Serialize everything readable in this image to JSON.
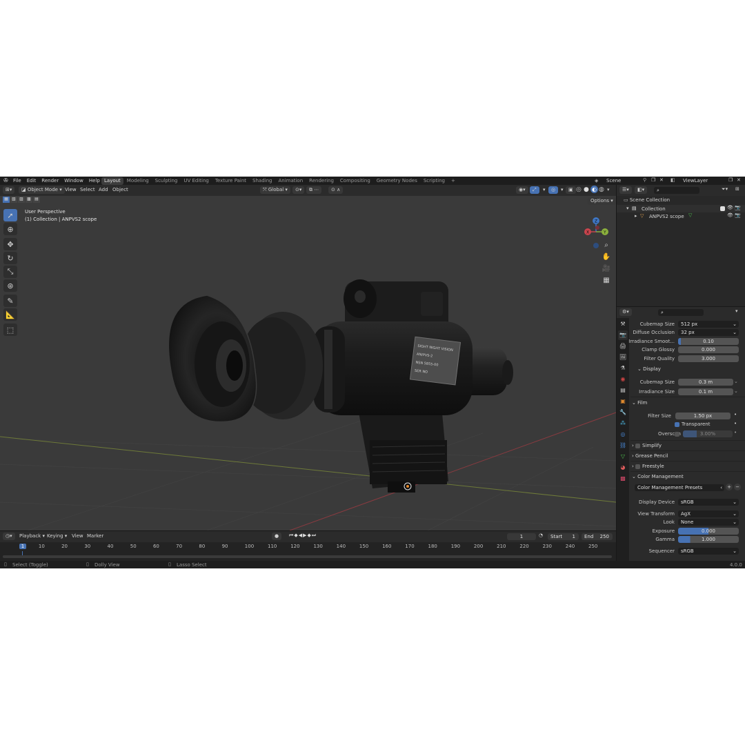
{
  "topbar": {
    "menus": [
      "File",
      "Edit",
      "Render",
      "Window",
      "Help"
    ],
    "workspaces": [
      "Layout",
      "Modeling",
      "Sculpting",
      "UV Editing",
      "Texture Paint",
      "Shading",
      "Animation",
      "Rendering",
      "Compositing",
      "Geometry Nodes",
      "Scripting"
    ],
    "active_workspace": "Layout",
    "add_tab": "+",
    "scene": "Scene",
    "view_layer": "ViewLayer"
  },
  "viewport": {
    "mode": "Object Mode",
    "menus": [
      "View",
      "Select",
      "Add",
      "Object"
    ],
    "orientation": "Global",
    "options_label": "Options",
    "overlay_line1": "User Perspective",
    "overlay_line2": "(1) Collection | ANPVS2 scope",
    "gizmo": {
      "z": "Z",
      "y": "Y",
      "x": "X"
    },
    "plate_lines": [
      "SIGHT NIGHT VISION",
      "AN/PVS-2",
      "NSN 5855-00",
      "SER NO"
    ]
  },
  "timeline": {
    "menus": [
      "Playback",
      "Keying",
      "View",
      "Marker"
    ],
    "current_frame": "1",
    "start_label": "Start",
    "start": "1",
    "end_label": "End",
    "end": "250",
    "ticks": [
      "1",
      "10",
      "20",
      "30",
      "40",
      "50",
      "60",
      "70",
      "80",
      "90",
      "100",
      "110",
      "120",
      "130",
      "140",
      "150",
      "160",
      "170",
      "180",
      "190",
      "200",
      "210",
      "220",
      "230",
      "240",
      "250"
    ]
  },
  "status": {
    "select": "Select (Toggle)",
    "dolly": "Dolly View",
    "lasso": "Lasso Select",
    "version": "4.0.0"
  },
  "outliner": {
    "scene_collection": "Scene Collection",
    "collection": "Collection",
    "object": "ANPVS2 scope"
  },
  "properties": {
    "cubemap_size_label": "Cubemap Size",
    "cubemap_size": "512 px",
    "diffuse_occlusion_label": "Diffuse Occlusion",
    "diffuse_occlusion": "32 px",
    "irradiance_smooth_label": "Irradiance Smoot...",
    "irradiance_smooth": "0.10",
    "irradiance_smooth_fill": 0.05,
    "clamp_glossy_label": "Clamp Glossy",
    "clamp_glossy": "0.000",
    "filter_quality_label": "Filter Quality",
    "filter_quality": "3.000",
    "display_section": "Display",
    "display_cubemap_label": "Cubemap Size",
    "display_cubemap": "0.3 m",
    "display_irradiance_label": "Irradiance Size",
    "display_irradiance": "0.1 m",
    "film_section": "Film",
    "filter_size_label": "Filter Size",
    "filter_size": "1.50 px",
    "transparent_label": "Transparent",
    "overscan_label": "Overscan",
    "overscan": "3.00%",
    "simplify_section": "Simplify",
    "grease_pencil_section": "Grease Pencil",
    "freestyle_section": "Freestyle",
    "color_management_section": "Color Management",
    "presets_label": "Color Management Presets",
    "display_device_label": "Display Device",
    "display_device": "sRGB",
    "view_transform_label": "View Transform",
    "view_transform": "AgX",
    "look_label": "Look",
    "look": "None",
    "exposure_label": "Exposure",
    "exposure": "0.000",
    "gamma_label": "Gamma",
    "gamma": "1.000",
    "sequencer_label": "Sequencer",
    "sequencer": "sRGB"
  },
  "colors": {
    "accent": "#4772b3",
    "axis_x": "#c9444d",
    "axis_y": "#8bb03d",
    "axis_z": "#3f76c4"
  }
}
